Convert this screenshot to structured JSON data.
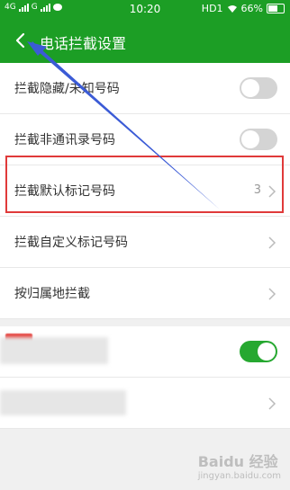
{
  "status_bar": {
    "left_indicators": [
      "4G",
      "G"
    ],
    "time": "10:20",
    "hd_label": "HD1",
    "battery": "66%"
  },
  "header": {
    "title": "电话拦截设置"
  },
  "settings": [
    {
      "label": "拦截隐藏/未知号码",
      "control": "toggle",
      "enabled": false
    },
    {
      "label": "拦截非通讯录号码",
      "control": "toggle",
      "enabled": false
    },
    {
      "label": "拦截默认标记号码",
      "control": "chevron",
      "count": "3"
    },
    {
      "label": "拦截自定义标记号码",
      "control": "chevron"
    },
    {
      "label": "按归属地拦截",
      "control": "chevron"
    }
  ],
  "extra_section": [
    {
      "control": "toggle",
      "enabled": true
    },
    {
      "control": "chevron"
    }
  ],
  "watermark": {
    "text": "Baidu 经验",
    "sub": "jingyan.baidu.com"
  },
  "colors": {
    "accent": "#1c9e25",
    "highlight": "#e03a3a",
    "arrow": "#3b5bd6"
  }
}
